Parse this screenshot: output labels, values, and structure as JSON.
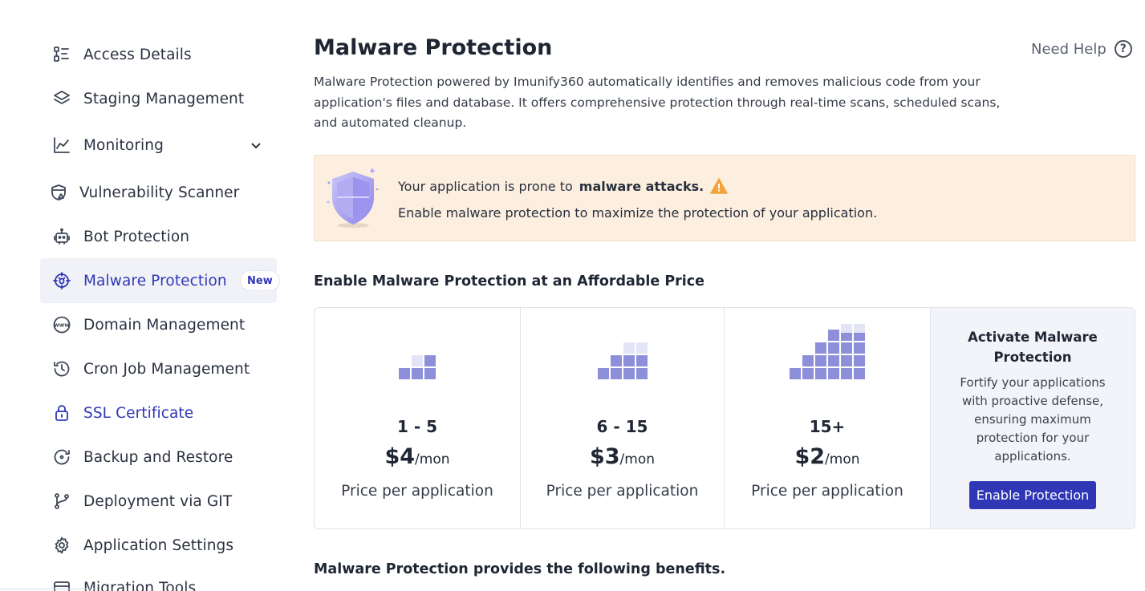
{
  "sidebar": {
    "items": [
      {
        "label": "Access Details",
        "icon": "access-details-icon"
      },
      {
        "label": "Staging Management",
        "icon": "layers-icon"
      },
      {
        "label": "Monitoring",
        "icon": "line-chart-icon"
      },
      {
        "label": "Vulnerability Scanner",
        "icon": "shield-scan-icon"
      },
      {
        "label": "Bot Protection",
        "icon": "robot-icon"
      },
      {
        "label": "Malware Protection",
        "icon": "target-bug-icon",
        "badge": "New"
      },
      {
        "label": "Domain Management",
        "icon": "www-icon"
      },
      {
        "label": "Cron Job Management",
        "icon": "history-icon"
      },
      {
        "label": "SSL Certificate",
        "icon": "lock-icon"
      },
      {
        "label": "Backup and Restore",
        "icon": "restore-icon"
      },
      {
        "label": "Deployment via GIT",
        "icon": "git-branch-icon"
      },
      {
        "label": "Application Settings",
        "icon": "gear-icon"
      },
      {
        "label": "Migration Tools",
        "icon": "migration-icon"
      }
    ],
    "active_index": 5
  },
  "header": {
    "title": "Malware Protection",
    "help_label": "Need Help",
    "help_icon": "question-circle-icon"
  },
  "description": "Malware Protection powered by Imunify360 automatically identifies and removes malicious code from your application's files and database. It offers comprehensive protection through real-time scans, scheduled scans, and automated cleanup.",
  "alert": {
    "line1_prefix": "Your application is prone to",
    "line1_bold": "malware attacks.",
    "line2": "Enable malware protection to maximize the protection of your application.",
    "icon": "warning-triangle-icon"
  },
  "pricing": {
    "title": "Enable Malware Protection at an Affordable Price",
    "tiers": [
      {
        "range": "1 - 5",
        "amount": "$4",
        "unit": "/mon",
        "note": "Price per application"
      },
      {
        "range": "6 - 15",
        "amount": "$3",
        "unit": "/mon",
        "note": "Price per application"
      },
      {
        "range": "15+",
        "amount": "$2",
        "unit": "/mon",
        "note": "Price per application"
      }
    ],
    "activate": {
      "title": "Activate Malware Protection",
      "text": "Fortify your applications with proactive defense, ensuring maximum protection for your applications.",
      "button": "Enable Protection"
    }
  },
  "benefits_title": "Malware Protection provides the following benefits.",
  "colors": {
    "accent": "#2f37b6",
    "alert_bg": "#fdefdf",
    "block_dark": "#8d8fdb",
    "block_light": "#e3e4f6"
  }
}
